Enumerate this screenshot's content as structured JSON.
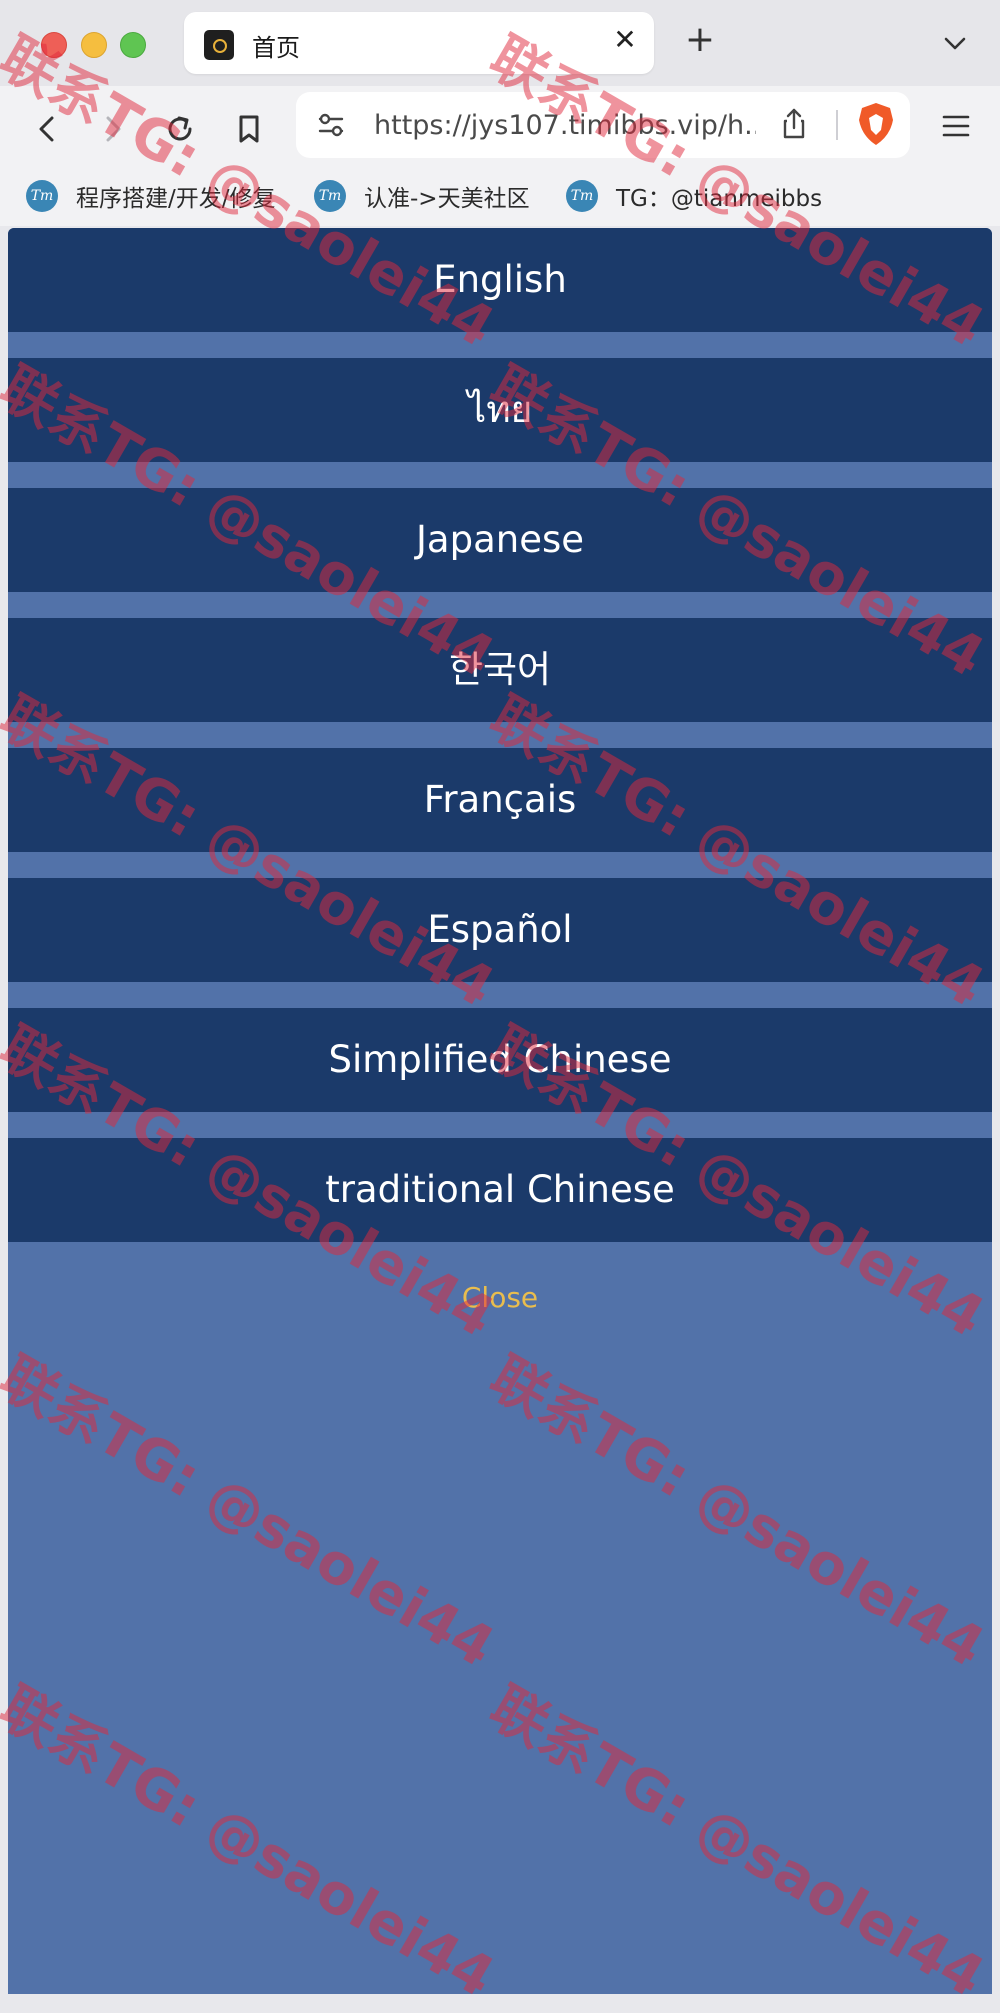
{
  "browser": {
    "tab": {
      "title": "首页",
      "close_glyph": "✕"
    },
    "new_tab_glyph": "+",
    "url": "https://jys107.timibbs.vip/h...",
    "bookmarks": [
      {
        "icon": "Tm",
        "label": "程序搭建/开发/修复"
      },
      {
        "icon": "Tm",
        "label": "认准->天美社区"
      },
      {
        "icon": "Tm",
        "label": "TG：@tianmeibbs"
      }
    ]
  },
  "language_menu": {
    "items": [
      {
        "label": "English"
      },
      {
        "label": "ไทย"
      },
      {
        "label": "Japanese"
      },
      {
        "label": "한국어"
      },
      {
        "label": "Français"
      },
      {
        "label": "Español"
      },
      {
        "label": "Simplified Chinese"
      },
      {
        "label": "traditional Chinese"
      }
    ],
    "close_label": "Close"
  },
  "watermark": {
    "text": "联系TG: @saolei44"
  },
  "colors": {
    "menu_item_bg": "#1b3a6a",
    "overlay_bg": "#5272a9",
    "close_text": "#e9bd4e",
    "watermark": "#e0283c"
  },
  "icons": {
    "traffic_lights": [
      "close-window-icon",
      "minimize-window-icon",
      "maximize-window-icon"
    ],
    "toolbar": [
      "back-arrow-icon",
      "forward-arrow-icon",
      "reload-icon",
      "bookmark-icon",
      "site-settings-icon",
      "share-icon",
      "brave-shield-icon",
      "hamburger-menu-icon"
    ]
  }
}
